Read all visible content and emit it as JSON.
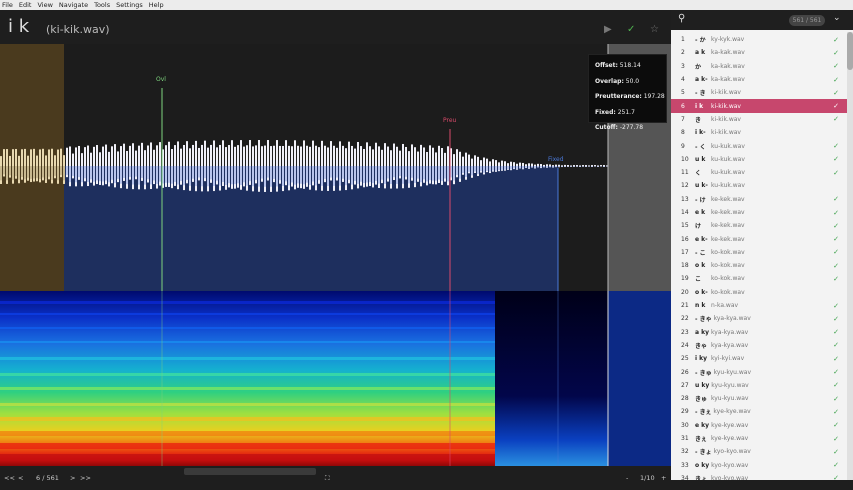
{
  "menu": [
    "File",
    "Edit",
    "View",
    "Navigate",
    "Tools",
    "Settings",
    "Help"
  ],
  "editor": {
    "alias": "i k",
    "filename": "(ki-kik.wav)",
    "icons": [
      "play-icon",
      "check-icon",
      "star-icon"
    ],
    "markers": {
      "ovl": "Ovl",
      "preu": "Preu",
      "fixed": "Fixed"
    },
    "info": [
      {
        "key": "Offset:",
        "value": "518.14"
      },
      {
        "key": "Overlap:",
        "value": "50.0"
      },
      {
        "key": "Preutterance:",
        "value": "197.28"
      },
      {
        "key": "Fixed:",
        "value": "251.7"
      },
      {
        "key": "Cutoff:",
        "value": "-277.78"
      }
    ]
  },
  "bottombar": {
    "first": "<<",
    "prev": "<",
    "position": "6 / 561",
    "next": ">",
    "last": ">>",
    "fit": "⛶",
    "zoom_out": "-",
    "zoom": "1/10",
    "zoom_in": "+"
  },
  "sidebar": {
    "count": "561 / 561",
    "rows": [
      {
        "num": "1",
        "alias": "- か",
        "file": "ky-kyk.wav",
        "ok": true
      },
      {
        "num": "2",
        "alias": "a k",
        "file": "ka-kak.wav",
        "ok": true
      },
      {
        "num": "3",
        "alias": "か",
        "file": "ka-kak.wav",
        "ok": true
      },
      {
        "num": "4",
        "alias": "a k-",
        "file": "ka-kak.wav",
        "ok": true
      },
      {
        "num": "5",
        "alias": "- き",
        "file": "ki-kik.wav",
        "ok": true
      },
      {
        "num": "6",
        "alias": "i k",
        "file": "ki-kik.wav",
        "ok": true,
        "selected": true
      },
      {
        "num": "7",
        "alias": "き",
        "file": "ki-kik.wav",
        "ok": true
      },
      {
        "num": "8",
        "alias": "i k-",
        "file": "ki-kik.wav",
        "ok": false
      },
      {
        "num": "9",
        "alias": "- く",
        "file": "ku-kuk.wav",
        "ok": true
      },
      {
        "num": "10",
        "alias": "u k",
        "file": "ku-kuk.wav",
        "ok": true
      },
      {
        "num": "11",
        "alias": "く",
        "file": "ku-kuk.wav",
        "ok": true
      },
      {
        "num": "12",
        "alias": "u k-",
        "file": "ku-kuk.wav",
        "ok": false
      },
      {
        "num": "13",
        "alias": "- け",
        "file": "ke-kek.wav",
        "ok": true
      },
      {
        "num": "14",
        "alias": "e k",
        "file": "ke-kek.wav",
        "ok": true
      },
      {
        "num": "15",
        "alias": "け",
        "file": "ke-kek.wav",
        "ok": true
      },
      {
        "num": "16",
        "alias": "e k-",
        "file": "ke-kek.wav",
        "ok": true
      },
      {
        "num": "17",
        "alias": "- こ",
        "file": "ko-kok.wav",
        "ok": true
      },
      {
        "num": "18",
        "alias": "o k",
        "file": "ko-kok.wav",
        "ok": true
      },
      {
        "num": "19",
        "alias": "こ",
        "file": "ko-kok.wav",
        "ok": true
      },
      {
        "num": "20",
        "alias": "o k-",
        "file": "ko-kok.wav",
        "ok": false
      },
      {
        "num": "21",
        "alias": "n k",
        "file": "n-ka.wav",
        "ok": true
      },
      {
        "num": "22",
        "alias": "- きゃ",
        "file": "kya-kya.wav",
        "ok": true
      },
      {
        "num": "23",
        "alias": "a ky",
        "file": "kya-kya.wav",
        "ok": true
      },
      {
        "num": "24",
        "alias": "きゃ",
        "file": "kya-kya.wav",
        "ok": true
      },
      {
        "num": "25",
        "alias": "i ky",
        "file": "kyi-kyi.wav",
        "ok": true
      },
      {
        "num": "26",
        "alias": "- きゅ",
        "file": "kyu-kyu.wav",
        "ok": true
      },
      {
        "num": "27",
        "alias": "u ky",
        "file": "kyu-kyu.wav",
        "ok": true
      },
      {
        "num": "28",
        "alias": "きゅ",
        "file": "kyu-kyu.wav",
        "ok": true
      },
      {
        "num": "29",
        "alias": "- きぇ",
        "file": "kye-kye.wav",
        "ok": true
      },
      {
        "num": "30",
        "alias": "e ky",
        "file": "kye-kye.wav",
        "ok": true
      },
      {
        "num": "31",
        "alias": "きぇ",
        "file": "kye-kye.wav",
        "ok": true
      },
      {
        "num": "32",
        "alias": "- きょ",
        "file": "kyo-kyo.wav",
        "ok": true
      },
      {
        "num": "33",
        "alias": "o ky",
        "file": "kyo-kyo.wav",
        "ok": true
      },
      {
        "num": "34",
        "alias": "きょ",
        "file": "kyo-kyo.wav",
        "ok": true
      }
    ]
  },
  "colors": {
    "selected_row": "#c7476d",
    "ovl_line": "#7ed37e",
    "preu_line": "#d94a6a",
    "fixed_line": "#4a78d8",
    "check": "#3ba04a"
  }
}
